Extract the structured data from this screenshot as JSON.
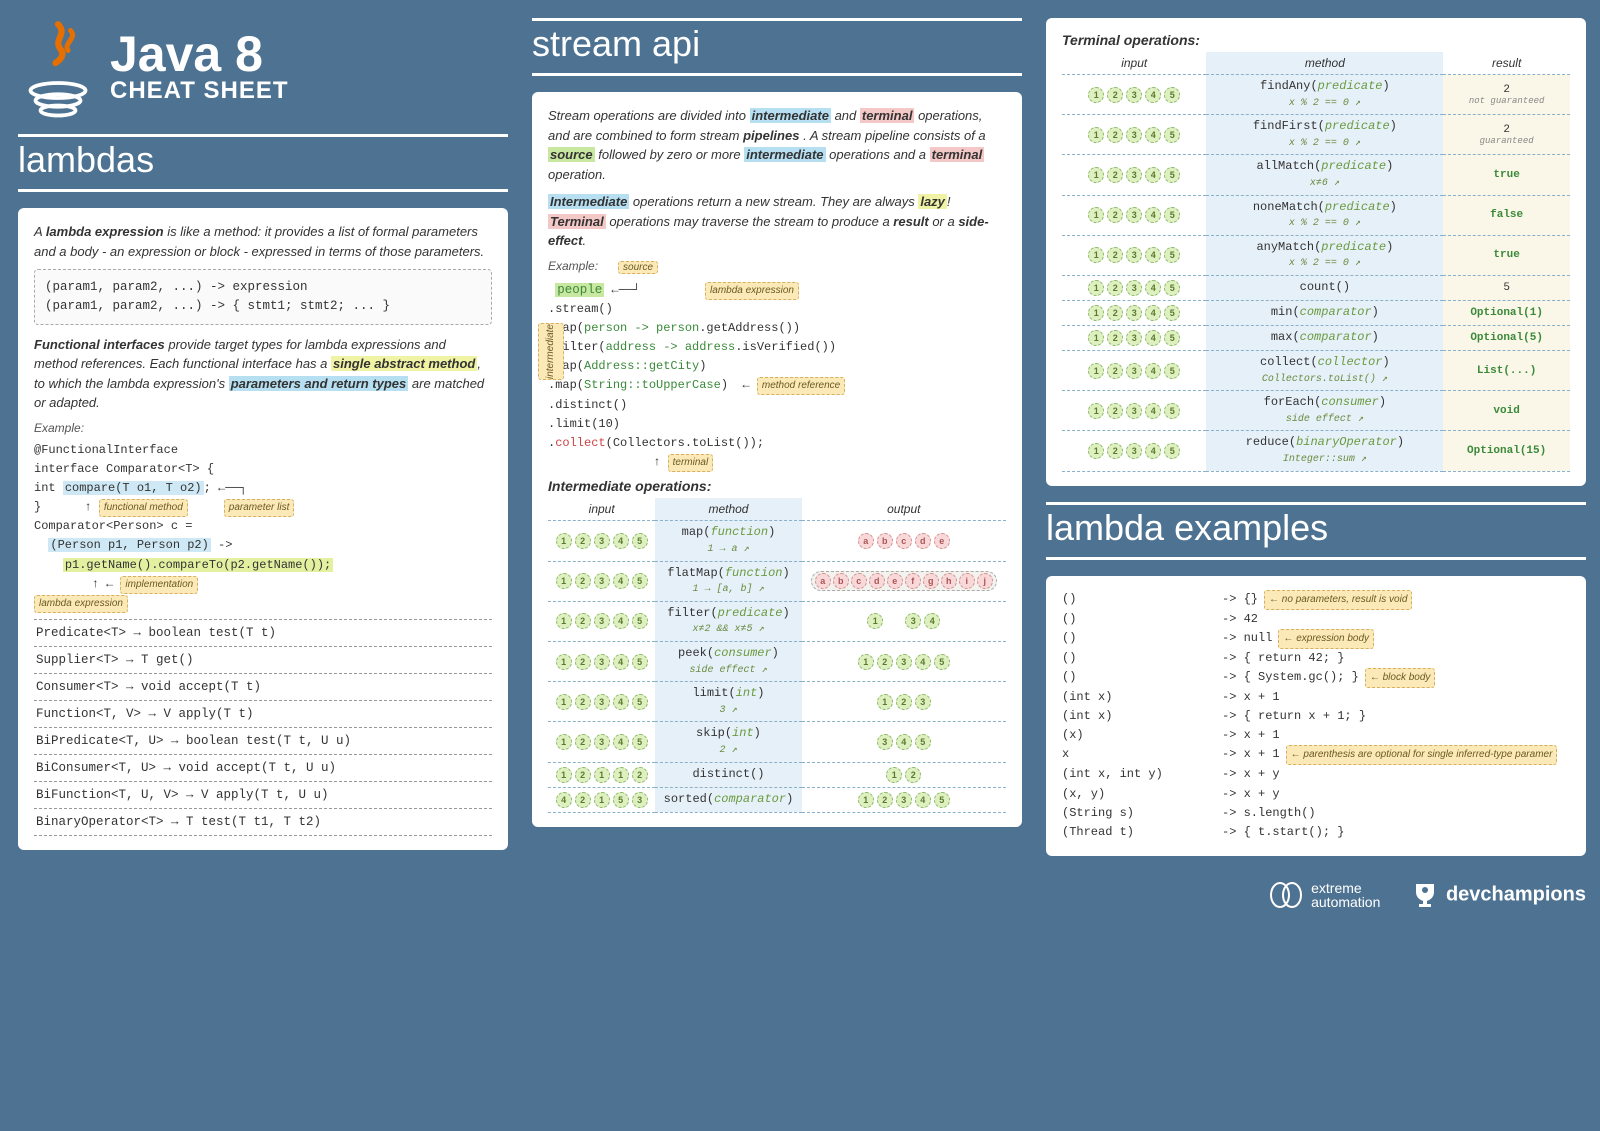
{
  "header": {
    "title": "Java 8",
    "subtitle": "CHEAT SHEET"
  },
  "lambdas": {
    "head": "lambdas",
    "intro_before": "A ",
    "intro_term": "lambda expression",
    "intro_after": " is like a method: it provides a list of formal parameters and a body - an expression or block - expressed in terms of those parameters.",
    "code1": "(param1, param2, ...) -> expression\n(param1, param2, ...) -> { stmt1; stmt2; ... }",
    "fi_term": "Functional interfaces",
    "fi_text1": " provide target types for lambda expressions and method references. Each functional interface has a ",
    "fi_sam": "single abstract method",
    "fi_text2": ", to which the lambda expression's ",
    "fi_params": "parameters and return types",
    "fi_text3": " are matched or adapted.",
    "example_label": "Example:",
    "ex_line1": "@FunctionalInterface",
    "ex_line2": "interface Comparator<T> {",
    "ex_line3_pre": "  int ",
    "ex_line3_hl": "compare(T o1, T o2)",
    "ex_line3_post": ";",
    "ex_line4": "}",
    "ex_annot_fm": "functional method",
    "ex_annot_pl": "parameter list",
    "ex_line5": "Comparator<Person> c =",
    "ex_line6_hl": "(Person p1, Person p2)",
    "ex_line6_post": " ->",
    "ex_line7_hl": "p1.getName().compareTo(p2.getName());",
    "ex_annot_impl": "implementation",
    "ex_annot_le": "lambda expression",
    "fns": [
      "Predicate<T> → boolean test(T t)",
      "Supplier<T> → T get()",
      "Consumer<T> → void accept(T t)",
      "Function<T, V> → V apply(T t)",
      "BiPredicate<T, U> → boolean test(T t, U u)",
      "BiConsumer<T, U> → void accept(T t, U u)",
      "BiFunction<T, U, V> → V apply(T t, U u)",
      "BinaryOperator<T> → T test(T t1, T t2)"
    ]
  },
  "stream": {
    "head": "stream api",
    "p1_a": "Stream operations are divided into ",
    "p1_inter": "intermediate",
    "p1_b": " and ",
    "p1_term": "terminal",
    "p1_c": " operations, and are combined to form stream ",
    "p1_pipe": "pipelines",
    "p1_d": ". A stream pipeline consists of a ",
    "p1_src": "source",
    "p1_e": " followed by zero or more ",
    "p1_inter2": "intermediate",
    "p1_f": " operations and a ",
    "p1_term2": "terminal",
    "p1_g": " operation.",
    "p2_inter": "Intermediate",
    "p2_a": " operations return a new stream. They are always ",
    "p2_lazy": "lazy",
    "p2_b": "! ",
    "p2_term": "Terminal",
    "p2_c": " operations may traverse the stream to produce a ",
    "p2_res": "result",
    "p2_d": " or a ",
    "p2_se": "side-effect",
    "p2_e": ".",
    "example_label": "Example:",
    "ex_annot_src": "source",
    "ex_annot_lambda": "lambda expression",
    "ex_annot_inter": "intermediate",
    "ex_annot_mref": "method reference",
    "ex_annot_term": "terminal",
    "ex_people": "people",
    "ex_l2": "  .stream()",
    "ex_l3a": "  .map(",
    "ex_l3b": "person -> person",
    "ex_l3c": ".getAddress())",
    "ex_l4a": "  .filter(",
    "ex_l4b": "address -> address",
    "ex_l4c": ".isVerified())",
    "ex_l5a": "  .map(",
    "ex_l5b": "Address::getCity",
    "ex_l5c": ")",
    "ex_l6a": "  .map(",
    "ex_l6b": "String::toUpperCase",
    "ex_l6c": ")",
    "ex_l7": "  .distinct()",
    "ex_l8": "  .limit(10)",
    "ex_l9a": "  .",
    "ex_l9b": "collect",
    "ex_l9c": "(Collectors.toList());",
    "inter_head": "Intermediate operations:",
    "inter_th": [
      "input",
      "method",
      "output"
    ],
    "inter_ops": [
      {
        "in": "12345",
        "meth": "map(function)",
        "note": "1 → a",
        "out": "abcde",
        "otype": "p"
      },
      {
        "in": "12345",
        "meth": "flatMap(function)",
        "note": "1 → [a, b]",
        "out": "abcdefghij",
        "otype": "p",
        "grouped": true
      },
      {
        "in": "12345",
        "meth": "filter(predicate)",
        "note": "x≠2 && x≠5",
        "out": "1 34",
        "otype": "g"
      },
      {
        "in": "12345",
        "meth": "peek(consumer)",
        "note": "side effect",
        "out": "12345",
        "otype": "g"
      },
      {
        "in": "12345",
        "meth": "limit(int)",
        "note": "3",
        "out": "123",
        "otype": "g"
      },
      {
        "in": "12345",
        "meth": "skip(int)",
        "note": "2",
        "out": "345",
        "otype": "g"
      },
      {
        "in": "12112",
        "meth": "distinct()",
        "note": "",
        "out": "12",
        "otype": "g"
      },
      {
        "in": "42153",
        "meth": "sorted(comparator)",
        "note": "",
        "out": "12345",
        "otype": "g"
      }
    ]
  },
  "terminal": {
    "head": "Terminal operations:",
    "th": [
      "input",
      "method",
      "result"
    ],
    "ops": [
      {
        "in": "12345",
        "meth": "findAny(predicate)",
        "note": "x % 2 == 0",
        "res": "2",
        "rnote": "not guaranteed"
      },
      {
        "in": "12345",
        "meth": "findFirst(predicate)",
        "note": "x % 2 == 0",
        "res": "2",
        "rnote": "guaranteed"
      },
      {
        "in": "12345",
        "meth": "allMatch(predicate)",
        "note": "x≠6",
        "res": "true",
        "rnote": ""
      },
      {
        "in": "12345",
        "meth": "noneMatch(predicate)",
        "note": "x % 2 == 0",
        "res": "false",
        "rnote": ""
      },
      {
        "in": "12345",
        "meth": "anyMatch(predicate)",
        "note": "x % 2 == 0",
        "res": "true",
        "rnote": ""
      },
      {
        "in": "12345",
        "meth": "count()",
        "note": "",
        "res": "5",
        "rnote": ""
      },
      {
        "in": "12345",
        "meth": "min(comparator)",
        "note": "",
        "res": "Optional(1)",
        "rnote": ""
      },
      {
        "in": "12345",
        "meth": "max(comparator)",
        "note": "",
        "res": "Optional(5)",
        "rnote": ""
      },
      {
        "in": "12345",
        "meth": "collect(collector)",
        "note": "Collectors.toList()",
        "res": "List(...)",
        "rnote": ""
      },
      {
        "in": "12345",
        "meth": "forEach(consumer)",
        "note": "side effect",
        "res": "void",
        "rnote": ""
      },
      {
        "in": "12345",
        "meth": "reduce(binaryOperator)",
        "note": "Integer::sum",
        "res": "Optional(15)",
        "rnote": ""
      }
    ]
  },
  "lambda_examples": {
    "head": "lambda examples",
    "rows": [
      {
        "l": "()",
        "r": "-> {}",
        "note": "no parameters, result is void"
      },
      {
        "l": "()",
        "r": "-> 42",
        "note": ""
      },
      {
        "l": "()",
        "r": "-> null",
        "note": "expression body"
      },
      {
        "l": "()",
        "r": "-> { return 42; }",
        "note": ""
      },
      {
        "l": "()",
        "r": "-> { System.gc(); }",
        "note": "block body"
      },
      {
        "l": "(int x)",
        "r": "-> x + 1",
        "note": ""
      },
      {
        "l": "(int x)",
        "r": "-> { return x + 1; }",
        "note": ""
      },
      {
        "l": "(x)",
        "r": "-> x + 1",
        "note": ""
      },
      {
        "l": "x",
        "r": "-> x + 1",
        "note": "parenthesis are optional for single inferred-type paramer"
      },
      {
        "l": "(int x, int y)",
        "r": "-> x + y",
        "note": ""
      },
      {
        "l": "(x, y)",
        "r": "-> x + y",
        "note": ""
      },
      {
        "l": "(String s)",
        "r": "-> s.length()",
        "note": ""
      },
      {
        "l": "(Thread t)",
        "r": "-> { t.start(); }",
        "note": ""
      }
    ]
  },
  "footer": {
    "b1a": "extreme",
    "b1b": "automation",
    "b2": "devchampions"
  }
}
